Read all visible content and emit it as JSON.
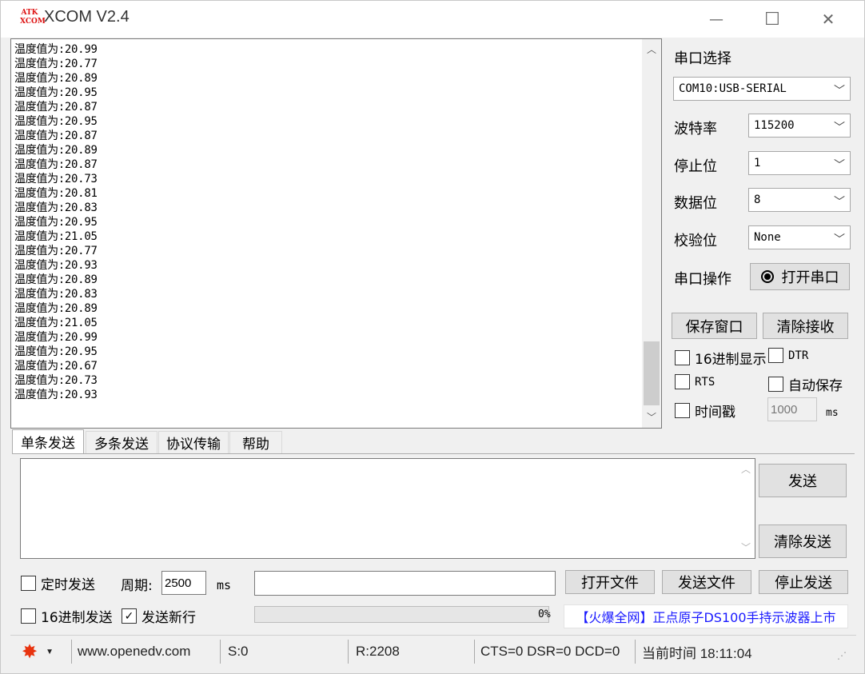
{
  "window": {
    "logo_top": "ATK",
    "logo_bottom": "XCOM",
    "title": "XCOM V2.4",
    "minimize_glyph": "—",
    "maximize_glyph": "☐",
    "close_glyph": "✕"
  },
  "receive": {
    "lines": [
      "温度值为:20.99",
      "温度值为:20.77",
      "温度值为:20.89",
      "温度值为:20.95",
      "温度值为:20.87",
      "温度值为:20.95",
      "温度值为:20.87",
      "温度值为:20.89",
      "温度值为:20.87",
      "温度值为:20.73",
      "温度值为:20.81",
      "温度值为:20.83",
      "温度值为:20.95",
      "温度值为:21.05",
      "温度值为:20.77",
      "温度值为:20.93",
      "温度值为:20.89",
      "温度值为:20.83",
      "温度值为:20.89",
      "温度值为:21.05",
      "温度值为:20.99",
      "温度值为:20.95",
      "温度值为:20.67",
      "温度值为:20.73",
      "温度值为:20.93"
    ],
    "scroll_fraction": 0.8
  },
  "serial": {
    "port_label": "串口选择",
    "port_value": "COM10:USB-SERIAL",
    "baud_label": "波特率",
    "baud_value": "115200",
    "stop_label": "停止位",
    "stop_value": "1",
    "data_label": "数据位",
    "data_value": "8",
    "parity_label": "校验位",
    "parity_value": "None",
    "op_label": "串口操作",
    "open_button": "打开串口",
    "save_window": "保存窗口",
    "clear_receive": "清除接收",
    "hex_display": "16进制显示",
    "dtr": "DTR",
    "rts": "RTS",
    "auto_save": "自动保存",
    "timestamp": "时间戳",
    "timestamp_value": "1000",
    "timestamp_unit": "ms"
  },
  "tabs": [
    "单条发送",
    "多条发送",
    "协议传输",
    "帮助"
  ],
  "send": {
    "send_button": "发送",
    "clear_send": "清除发送",
    "timed_send": "定时发送",
    "period_label": "周期:",
    "period_value": "2500",
    "period_unit": "ms",
    "open_file": "打开文件",
    "send_file": "发送文件",
    "stop_send": "停止发送",
    "hex_send": "16进制发送",
    "newline_send": "发送新行",
    "newline_checked": true,
    "progress_percent": "0%",
    "progress_value": 0,
    "ad_text": "【火爆全网】正点原子DS100手持示波器上市"
  },
  "statusbar": {
    "website": "www.openedv.com",
    "sent": "S:0",
    "received": "R:2208",
    "lines": "CTS=0 DSR=0 DCD=0",
    "time": "当前时间 18:11:04"
  },
  "colors": {
    "gear": "#e8330f",
    "ad_text": "#1a1aff",
    "logo": "#d11111"
  }
}
